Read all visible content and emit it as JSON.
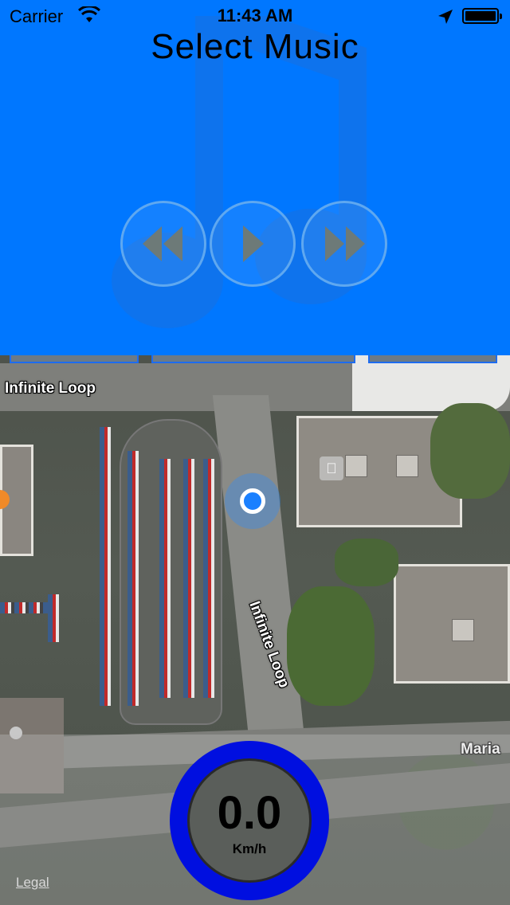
{
  "status_bar": {
    "carrier": "Carrier",
    "time": "11:43 AM",
    "icons": [
      "wifi-icon",
      "location-arrow-icon",
      "battery-icon"
    ]
  },
  "music": {
    "title": "Select Music",
    "background_color": "#0077ff",
    "controls": [
      {
        "id": "rewind",
        "icon": "rewind-icon"
      },
      {
        "id": "play",
        "icon": "play-icon"
      },
      {
        "id": "forward",
        "icon": "fast-forward-icon"
      }
    ]
  },
  "map": {
    "labels": [
      {
        "id": "top",
        "text": "Infinite Loop"
      },
      {
        "id": "rotated",
        "text": "Infinite Loop"
      },
      {
        "id": "right",
        "text": "Maria"
      }
    ],
    "legal": "Legal"
  },
  "speedometer": {
    "value": "0.0",
    "unit": "Km/h",
    "ring_color": "#000fe0"
  }
}
